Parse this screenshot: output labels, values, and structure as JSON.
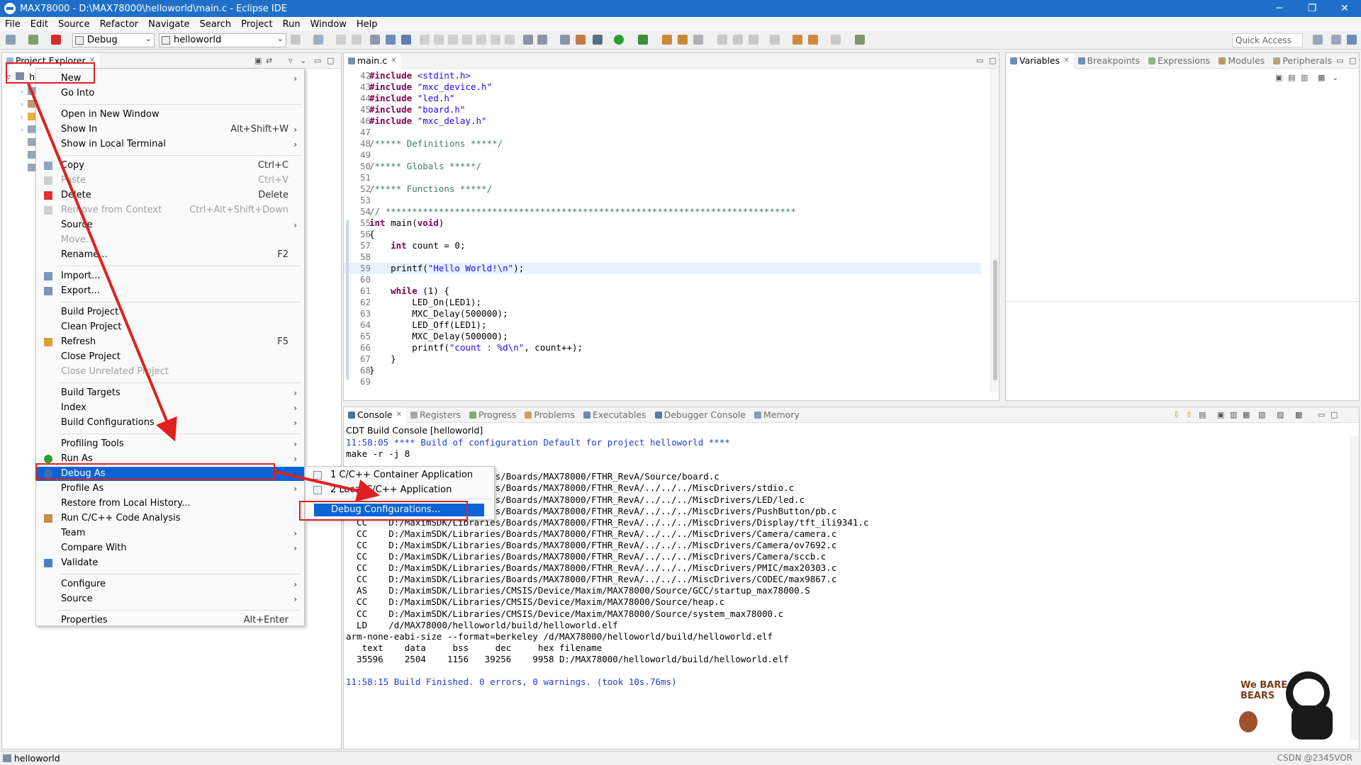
{
  "window": {
    "title": "MAX78000 - D:\\MAX78000\\helloworld\\main.c - Eclipse IDE",
    "minimize": "─",
    "maximize": "❐",
    "close": "✕"
  },
  "menubar": [
    "File",
    "Edit",
    "Source",
    "Refactor",
    "Navigate",
    "Search",
    "Project",
    "Run",
    "Window",
    "Help"
  ],
  "toolbar": {
    "launch_mode": "Debug",
    "launch_config": "helloworld",
    "quick_access": "Quick Access"
  },
  "explorer": {
    "tab": "Project Explorer",
    "project_label": "he"
  },
  "editor": {
    "tab": "main.c",
    "lines": [
      {
        "n": "42",
        "t": "#include <stdint.h>"
      },
      {
        "n": "43",
        "t": "#include \"mxc_device.h\""
      },
      {
        "n": "44",
        "t": "#include \"led.h\""
      },
      {
        "n": "45",
        "t": "#include \"board.h\""
      },
      {
        "n": "46",
        "t": "#include \"mxc_delay.h\""
      },
      {
        "n": "47",
        "t": ""
      },
      {
        "n": "48",
        "t": "/***** Definitions *****/"
      },
      {
        "n": "49",
        "t": ""
      },
      {
        "n": "50",
        "t": "/***** Globals *****/"
      },
      {
        "n": "51",
        "t": ""
      },
      {
        "n": "52",
        "t": "/***** Functions *****/"
      },
      {
        "n": "53",
        "t": ""
      },
      {
        "n": "54",
        "t": "// *****************************************************************************"
      },
      {
        "n": "55",
        "t": "int main(void)"
      },
      {
        "n": "56",
        "t": "{"
      },
      {
        "n": "57",
        "t": "    int count = 0;"
      },
      {
        "n": "58",
        "t": ""
      },
      {
        "n": "59",
        "t": "    printf(\"Hello World!\\n\");"
      },
      {
        "n": "60",
        "t": ""
      },
      {
        "n": "61",
        "t": "    while (1) {"
      },
      {
        "n": "62",
        "t": "        LED_On(LED1);"
      },
      {
        "n": "63",
        "t": "        MXC_Delay(500000);"
      },
      {
        "n": "64",
        "t": "        LED_Off(LED1);"
      },
      {
        "n": "65",
        "t": "        MXC_Delay(500000);"
      },
      {
        "n": "66",
        "t": "        printf(\"count : %d\\n\", count++);"
      },
      {
        "n": "67",
        "t": "    }"
      },
      {
        "n": "68",
        "t": "}"
      },
      {
        "n": "69",
        "t": ""
      }
    ]
  },
  "debug_views": {
    "tabs": [
      "Variables",
      "Breakpoints",
      "Expressions",
      "Modules",
      "Peripherals"
    ]
  },
  "console": {
    "tabs": [
      "Console",
      "Registers",
      "Progress",
      "Problems",
      "Executables",
      "Debugger Console",
      "Memory"
    ],
    "title": "CDT Build Console [helloworld]",
    "lines": [
      {
        "t": "11:58:05 **** Build of configuration Default for project helloworld ****",
        "c": "blue"
      },
      {
        "t": "make -r -j 8",
        "c": "black"
      },
      {
        "t": "",
        "c": "black"
      },
      {
        "t": "  CC    D:/MaximSDK/Libraries/Boards/MAX78000/FTHR_RevA/Source/board.c",
        "c": "black"
      },
      {
        "t": "  CC    D:/MaximSDK/Libraries/Boards/MAX78000/FTHR_RevA/../../../MiscDrivers/stdio.c",
        "c": "black"
      },
      {
        "t": "  CC    D:/MaximSDK/Libraries/Boards/MAX78000/FTHR_RevA/../../../MiscDrivers/LED/led.c",
        "c": "black"
      },
      {
        "t": "  CC    D:/MaximSDK/Libraries/Boards/MAX78000/FTHR_RevA/../../../MiscDrivers/PushButton/pb.c",
        "c": "black"
      },
      {
        "t": "  CC    D:/MaximSDK/Libraries/Boards/MAX78000/FTHR_RevA/../../../MiscDrivers/Display/tft_ili9341.c",
        "c": "black"
      },
      {
        "t": "  CC    D:/MaximSDK/Libraries/Boards/MAX78000/FTHR_RevA/../../../MiscDrivers/Camera/camera.c",
        "c": "black"
      },
      {
        "t": "  CC    D:/MaximSDK/Libraries/Boards/MAX78000/FTHR_RevA/../../../MiscDrivers/Camera/ov7692.c",
        "c": "black"
      },
      {
        "t": "  CC    D:/MaximSDK/Libraries/Boards/MAX78000/FTHR_RevA/../../../MiscDrivers/Camera/sccb.c",
        "c": "black"
      },
      {
        "t": "  CC    D:/MaximSDK/Libraries/Boards/MAX78000/FTHR_RevA/../../../MiscDrivers/PMIC/max20303.c",
        "c": "black"
      },
      {
        "t": "  CC    D:/MaximSDK/Libraries/Boards/MAX78000/FTHR_RevA/../../../MiscDrivers/CODEC/max9867.c",
        "c": "black"
      },
      {
        "t": "  AS    D:/MaximSDK/Libraries/CMSIS/Device/Maxim/MAX78000/Source/GCC/startup_max78000.S",
        "c": "black"
      },
      {
        "t": "  CC    D:/MaximSDK/Libraries/CMSIS/Device/Maxim/MAX78000/Source/heap.c",
        "c": "black"
      },
      {
        "t": "  CC    D:/MaximSDK/Libraries/CMSIS/Device/Maxim/MAX78000/Source/system_max78000.c",
        "c": "black"
      },
      {
        "t": "  LD    /d/MAX78000/helloworld/build/helloworld.elf",
        "c": "black"
      },
      {
        "t": "arm-none-eabi-size --format=berkeley /d/MAX78000/helloworld/build/helloworld.elf",
        "c": "black"
      },
      {
        "t": "   text    data     bss     dec     hex filename",
        "c": "black"
      },
      {
        "t": "  35596    2504    1156   39256    9958 D:/MAX78000/helloworld/build/helloworld.elf",
        "c": "black"
      },
      {
        "t": "",
        "c": "black"
      },
      {
        "t": "11:58:15 Build Finished. 0 errors, 0 warnings. (took 10s.76ms)",
        "c": "blue"
      }
    ]
  },
  "context_menu": {
    "items": [
      {
        "label": "New",
        "shortcut": "",
        "arrow": true,
        "disabled": false
      },
      {
        "label": "Go Into",
        "shortcut": "",
        "arrow": false,
        "disabled": false
      },
      {
        "sep": true
      },
      {
        "label": "Open in New Window",
        "shortcut": "",
        "arrow": false,
        "disabled": false
      },
      {
        "label": "Show In",
        "shortcut": "Alt+Shift+W",
        "arrow": true,
        "disabled": false
      },
      {
        "label": "Show in Local Terminal",
        "shortcut": "",
        "arrow": true,
        "disabled": false
      },
      {
        "sep": true
      },
      {
        "label": "Copy",
        "shortcut": "Ctrl+C",
        "arrow": false,
        "disabled": false,
        "icon": "copy-icon"
      },
      {
        "label": "Paste",
        "shortcut": "Ctrl+V",
        "arrow": false,
        "disabled": true,
        "icon": "paste-icon"
      },
      {
        "label": "Delete",
        "shortcut": "Delete",
        "arrow": false,
        "disabled": false,
        "icon": "delete-icon"
      },
      {
        "label": "Remove from Context",
        "shortcut": "Ctrl+Alt+Shift+Down",
        "arrow": false,
        "disabled": true,
        "icon": "remove-context-icon"
      },
      {
        "label": "Source",
        "shortcut": "",
        "arrow": true,
        "disabled": false
      },
      {
        "label": "Move...",
        "shortcut": "",
        "arrow": false,
        "disabled": true
      },
      {
        "label": "Rename...",
        "shortcut": "F2",
        "arrow": false,
        "disabled": false
      },
      {
        "sep": true
      },
      {
        "label": "Import...",
        "shortcut": "",
        "arrow": false,
        "disabled": false,
        "icon": "import-icon"
      },
      {
        "label": "Export...",
        "shortcut": "",
        "arrow": false,
        "disabled": false,
        "icon": "export-icon"
      },
      {
        "sep": true
      },
      {
        "label": "Build Project",
        "shortcut": "",
        "arrow": false,
        "disabled": false
      },
      {
        "label": "Clean Project",
        "shortcut": "",
        "arrow": false,
        "disabled": false
      },
      {
        "label": "Refresh",
        "shortcut": "F5",
        "arrow": false,
        "disabled": false,
        "icon": "refresh-icon"
      },
      {
        "label": "Close Project",
        "shortcut": "",
        "arrow": false,
        "disabled": false
      },
      {
        "label": "Close Unrelated Project",
        "shortcut": "",
        "arrow": false,
        "disabled": true
      },
      {
        "sep": true
      },
      {
        "label": "Build Targets",
        "shortcut": "",
        "arrow": true,
        "disabled": false
      },
      {
        "label": "Index",
        "shortcut": "",
        "arrow": true,
        "disabled": false
      },
      {
        "label": "Build Configurations",
        "shortcut": "",
        "arrow": true,
        "disabled": false
      },
      {
        "sep": true
      },
      {
        "label": "Profiling Tools",
        "shortcut": "",
        "arrow": true,
        "disabled": false
      },
      {
        "label": "Run As",
        "shortcut": "",
        "arrow": true,
        "disabled": false,
        "icon": "run-icon"
      },
      {
        "label": "Debug As",
        "shortcut": "",
        "arrow": true,
        "disabled": false,
        "highlight": true,
        "icon": "debug-icon"
      },
      {
        "label": "Profile As",
        "shortcut": "",
        "arrow": true,
        "disabled": false
      },
      {
        "label": "Restore from Local History...",
        "shortcut": "",
        "arrow": false,
        "disabled": false
      },
      {
        "label": "Run C/C++ Code Analysis",
        "shortcut": "",
        "arrow": false,
        "disabled": false,
        "icon": "code-analysis-icon"
      },
      {
        "label": "Team",
        "shortcut": "",
        "arrow": true,
        "disabled": false
      },
      {
        "label": "Compare With",
        "shortcut": "",
        "arrow": true,
        "disabled": false
      },
      {
        "label": "Validate",
        "shortcut": "",
        "arrow": false,
        "disabled": false,
        "icon": "validate-check-icon"
      },
      {
        "sep": true
      },
      {
        "label": "Configure",
        "shortcut": "",
        "arrow": true,
        "disabled": false
      },
      {
        "label": "Source",
        "shortcut": "",
        "arrow": true,
        "disabled": false
      },
      {
        "sep": true
      },
      {
        "label": "Properties",
        "shortcut": "Alt+Enter",
        "arrow": false,
        "disabled": false
      }
    ]
  },
  "submenu": {
    "items": [
      "1 C/C++ Container Application",
      "2 Local C/C++ Application"
    ],
    "debug_configurations": "Debug Configurations..."
  },
  "status": {
    "project": "helloworld"
  },
  "watermark": {
    "credit": "CSDN @2345VOR",
    "logo_text": "We BARE BEARS"
  },
  "colors": {
    "menu_highlight": "#0a64d6",
    "annotation_red": "#e02020",
    "titlebar": "#1f6fc9"
  }
}
